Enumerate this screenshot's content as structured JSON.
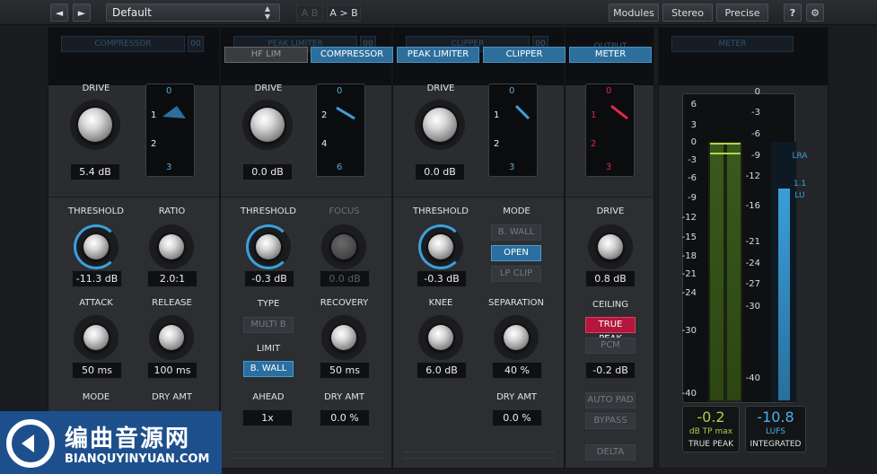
{
  "toolbar": {
    "back_label": "◄",
    "fwd_label": "►",
    "preset": "Default",
    "ab_a": "A B",
    "ab_b": "A > B",
    "modules": "Modules",
    "stereo": "Stereo",
    "precise": "Precise",
    "help": "?",
    "gear": "⚙"
  },
  "tabs": [
    "HF LIM",
    "COMPRESSOR",
    "PEAK LIMITER",
    "CLIPPER",
    "METER"
  ],
  "compressor": {
    "title": "COMPRESSOR",
    "slot": "00",
    "drive_label": "DRIVE",
    "drive": "5.4 dB",
    "graph": [
      "0",
      "1",
      "2",
      "3"
    ],
    "threshold_label": "THRESHOLD",
    "threshold": "-11.3 dB",
    "ratio_label": "RATIO",
    "ratio": "2.0:1",
    "attack_label": "ATTACK",
    "attack": "50 ms",
    "release_label": "RELEASE",
    "release": "100 ms",
    "mode_label": "MODE",
    "dry_label": "DRY AMT"
  },
  "peak": {
    "title": "PEAK LIMITER",
    "slot": "00",
    "drive_label": "DRIVE",
    "drive": "0.0 dB",
    "graph": [
      "0",
      "2",
      "4",
      "6"
    ],
    "threshold_label": "THRESHOLD",
    "threshold": "-0.3 dB",
    "focus_label": "FOCUS",
    "focus": "0.0 dB",
    "type_label": "TYPE",
    "type_btn": "MULTI B",
    "limit_label": "LIMIT",
    "limit_btn": "B. WALL",
    "recovery_label": "RECOVERY",
    "recovery": "50 ms",
    "ahead_label": "AHEAD",
    "ahead": "1x",
    "dry_label": "DRY AMT",
    "dry": "0.0 %"
  },
  "clipper": {
    "title": "CLIPPER",
    "slot": "00",
    "drive_label": "DRIVE",
    "drive": "0.0 dB",
    "graph": [
      "0",
      "1",
      "2",
      "3"
    ],
    "threshold_label": "THRESHOLD",
    "threshold": "-0.3 dB",
    "mode_label": "MODE",
    "modes": [
      "B. WALL",
      "OPEN",
      "LP CLIP"
    ],
    "knee_label": "KNEE",
    "knee": "6.0 dB",
    "sep_label": "SEPARATION",
    "sep": "40 %",
    "dry_label": "DRY AMT",
    "dry": "0.0 %"
  },
  "output": {
    "title": "OUTPUT",
    "graph": [
      "0",
      "1",
      "2",
      "3"
    ],
    "drive_label": "DRIVE",
    "drive": "0.8 dB",
    "ceiling_label": "CEILING",
    "true_peak": "TRUE PEAK",
    "pcm": "PCM",
    "ceiling": "-0.2 dB",
    "auto_pad": "AUTO PAD",
    "bypass": "BYPASS",
    "delta": "DELTA"
  },
  "meter": {
    "title": "METER",
    "left_scale": [
      "6",
      "3",
      "0",
      "-3",
      "-6",
      "-9",
      "-12",
      "-15",
      "-18",
      "-21",
      "-24",
      "-30",
      "-40"
    ],
    "right_scale": [
      "0",
      "-3",
      "-6",
      "-9",
      "-12",
      "-16",
      "-21",
      "-24",
      "-27",
      "-30",
      "-40"
    ],
    "lra": "LRA",
    "lra_val": "1.1",
    "lu": "LU",
    "tp_value": "-0.2",
    "tp_unit": "dB TP max",
    "tp_label": "TRUE PEAK",
    "lufs_value": "-10.8",
    "lufs_unit": "LUFS",
    "lufs_label": "INTEGRATED"
  },
  "watermark": {
    "title": "编曲音源网",
    "url": "BIANQUYINYUAN.COM"
  },
  "colors": {
    "accent": "#2d6f9c",
    "knob_ring": "#3ba0dc",
    "red": "#b4163c",
    "meter_green": "#9bc53a",
    "meter_blue": "#3a9ed8"
  }
}
